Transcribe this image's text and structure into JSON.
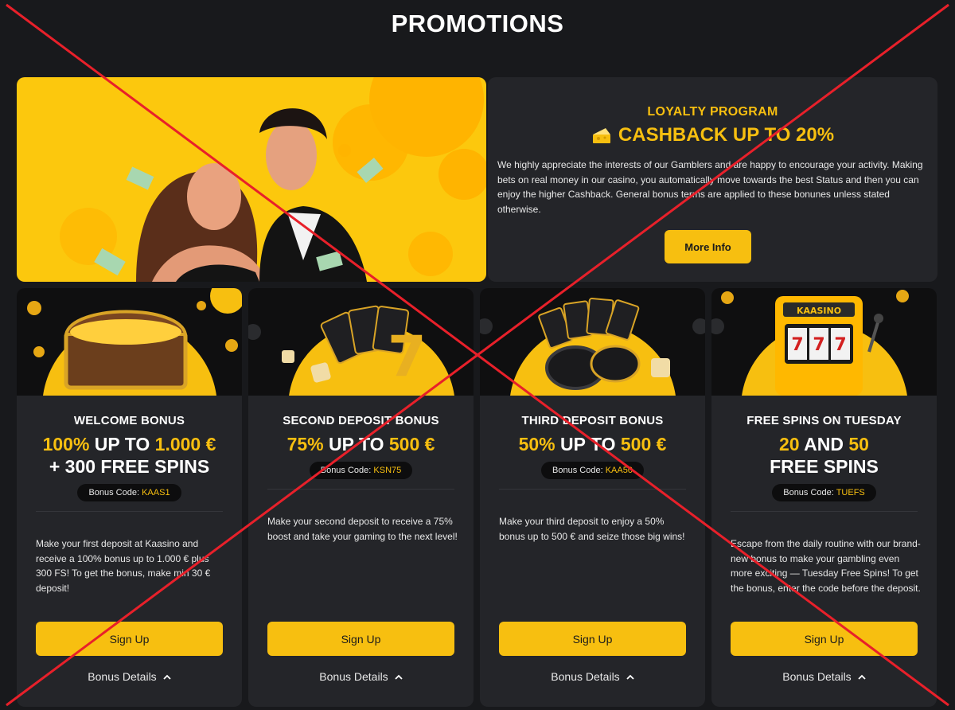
{
  "page": {
    "title": "PROMOTIONS"
  },
  "loyalty": {
    "label": "LOYALTY PROGRAM",
    "headline": "CASHBACK UP TO 20%",
    "icon": "cheese-icon",
    "description": "We highly appreciate the interests of our Gamblers and are happy to encourage your activity. Making bets on real money in our casino, you automatically move towards the best Status and then you can enjoy the higher Cashback. General bonus terms are applied to these bonunes unless stated otherwise.",
    "button": "More Info"
  },
  "cards": [
    {
      "title": "WELCOME BONUS",
      "offer": {
        "line1": [
          "100%",
          " UP TO ",
          "1.000 €"
        ],
        "line2": "+ 300 FREE SPINS"
      },
      "code_label": "Bonus Code: ",
      "code": "KAAS1",
      "description": "Make your first deposit at Kaasino and receive a 100% bonus up to 1.000 € plus 300 FS! To get the bonus, make min 30 € deposit!",
      "button": "Sign Up",
      "details": "Bonus Details"
    },
    {
      "title": "SECOND DEPOSIT BONUS",
      "offer": {
        "line1": [
          "75%",
          " UP TO ",
          "500 €"
        ],
        "line2": ""
      },
      "code_label": "Bonus Code: ",
      "code": "KSN75",
      "description": "Make your second deposit to receive a 75% boost and take your gaming to the next level!",
      "button": "Sign Up",
      "details": "Bonus Details"
    },
    {
      "title": "THIRD DEPOSIT BONUS",
      "offer": {
        "line1": [
          "50%",
          " UP TO ",
          "500 €"
        ],
        "line2": ""
      },
      "code_label": "Bonus Code: ",
      "code": "KAA50",
      "description": "Make your third deposit to enjoy a 50% bonus up to 500 €  and seize those big wins!",
      "button": "Sign Up",
      "details": "Bonus Details"
    },
    {
      "title": "FREE SPINS ON TUESDAY",
      "offer": {
        "line1": [
          "20",
          " AND ",
          "50"
        ],
        "line2": "FREE SPINS"
      },
      "code_label": "Bonus Code: ",
      "code": "TUEFS",
      "description": "Escape from the daily routine with our brand-new bonus to make your gambling even more exciting — Tuesday Free Spins! To get the bonus, enter the code before the deposit.",
      "button": "Sign Up",
      "details": "Bonus Details"
    }
  ],
  "slot_machine_logo": "KAASINO",
  "colors": {
    "accent": "#f7bf10",
    "background": "#18191c",
    "card": "#242529",
    "overlay_cross": "#e8202a"
  }
}
